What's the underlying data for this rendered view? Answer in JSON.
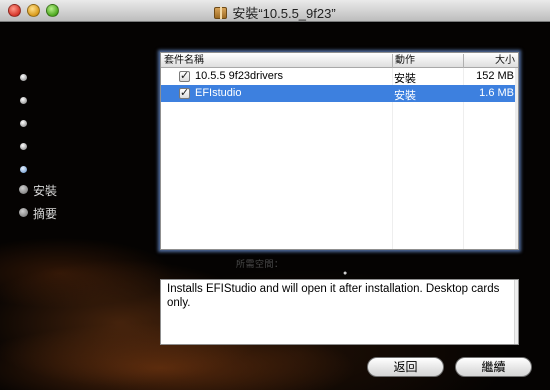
{
  "window": {
    "title": "安裝“10.5.5_9f23”"
  },
  "sidebar": {
    "steps": [
      {
        "label": "",
        "state": "done"
      },
      {
        "label": "",
        "state": "done"
      },
      {
        "label": "",
        "state": "done"
      },
      {
        "label": "",
        "state": "done"
      },
      {
        "label": "",
        "state": "current"
      },
      {
        "label": "安裝",
        "state": "future"
      },
      {
        "label": "摘要",
        "state": "future"
      }
    ]
  },
  "package_table": {
    "columns": {
      "name": "套件名稱",
      "action": "動作",
      "size": "大小"
    },
    "rows": [
      {
        "checked": true,
        "check_glyph": "✓",
        "name": "10.5.5 9f23drivers",
        "action": "安裝",
        "size": "152 MB",
        "selected": false
      },
      {
        "checked": true,
        "check_glyph": "✓",
        "name": "EFIstudio",
        "action": "安裝",
        "size": "1.6 MB",
        "selected": true
      }
    ]
  },
  "space_label": "所需空間：",
  "description": "Installs EFIStudio and will open it after installation.  Desktop cards only.",
  "buttons": {
    "back": "返回",
    "continue": "繼續"
  },
  "colors": {
    "selection": "#3d80df",
    "focus_ring": "#6e96dc"
  }
}
